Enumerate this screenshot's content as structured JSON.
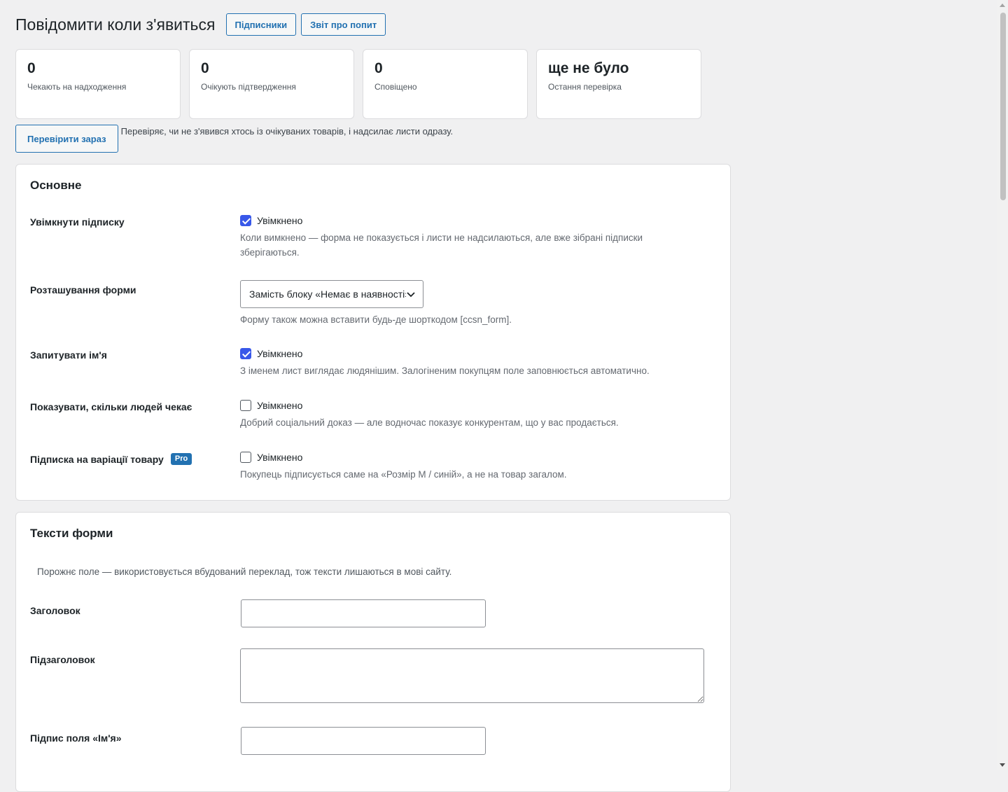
{
  "header": {
    "title": "Повідомити коли з'явиться",
    "buttons": [
      "Підписники",
      "Звіт про попит"
    ]
  },
  "stats": [
    {
      "value": "0",
      "label": "Чекають на надходження"
    },
    {
      "value": "0",
      "label": "Очікують підтвердження"
    },
    {
      "value": "0",
      "label": "Сповіщено"
    },
    {
      "value": "ще не було",
      "label": "Остання перевірка"
    }
  ],
  "check_now": {
    "button": "Перевірити зараз",
    "description": "Перевіряє, чи не з'явився хтось із очікуваних товарів, і надсилає листи одразу."
  },
  "general": {
    "title": "Основне",
    "enable_subscription": {
      "label": "Увімкнути підписку",
      "checkbox_label": "Увімкнено",
      "checked": true,
      "description": "Коли вимкнено — форма не показується і листи не надсилаються, але вже зібрані підписки зберігаються."
    },
    "form_position": {
      "label": "Розташування форми",
      "selected": "Замість блоку «Немає в наявності»",
      "description": "Форму також можна вставити будь-де шорткодом [ccsn_form]."
    },
    "ask_name": {
      "label": "Запитувати ім'я",
      "checkbox_label": "Увімкнено",
      "checked": true,
      "description": "З іменем лист виглядає людянішим. Залогіненим покупцям поле заповнюється автоматично."
    },
    "show_waiting": {
      "label": "Показувати, скільки людей чекає",
      "checkbox_label": "Увімкнено",
      "checked": false,
      "description": "Добрий соціальний доказ — але водночас показує конкурентам, що у вас продається."
    },
    "variation_subscription": {
      "label": "Підписка на варіації товару",
      "badge": "Pro",
      "checkbox_label": "Увімкнено",
      "checked": false,
      "description": "Покупець підписується саме на «Розмір M / синій», а не на товар загалом."
    }
  },
  "form_texts": {
    "title": "Тексти форми",
    "note": "Порожнє поле — використовується вбудований переклад, тож тексти лишаються в мові сайту.",
    "heading_label": "Заголовок",
    "heading_value": "",
    "subheading_label": "Підзаголовок",
    "subheading_value": "",
    "name_field_label": "Підпис поля «Ім'я»",
    "name_field_value": ""
  }
}
